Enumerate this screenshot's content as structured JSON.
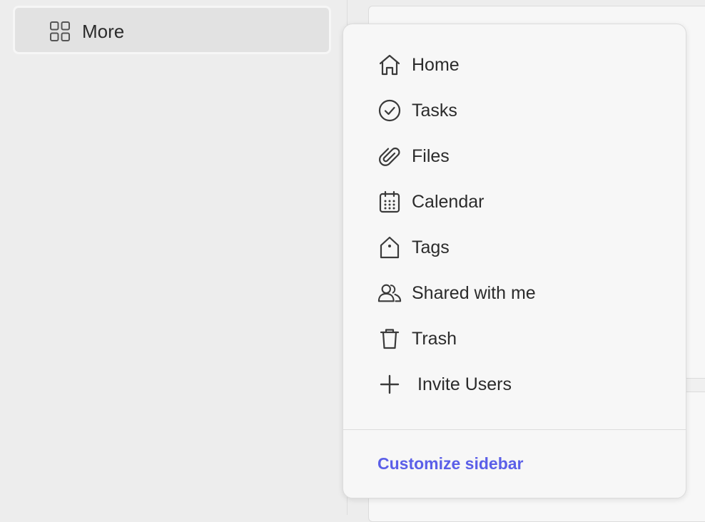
{
  "sidebar": {
    "more_item": {
      "label": "More",
      "icon": "grid-icon"
    }
  },
  "dropdown": {
    "items": [
      {
        "label": "Home",
        "icon": "home-icon"
      },
      {
        "label": "Tasks",
        "icon": "check-circle-icon"
      },
      {
        "label": "Files",
        "icon": "paperclip-icon"
      },
      {
        "label": "Calendar",
        "icon": "calendar-icon"
      },
      {
        "label": "Tags",
        "icon": "tag-icon"
      },
      {
        "label": "Shared with me",
        "icon": "users-icon"
      },
      {
        "label": "Trash",
        "icon": "trash-icon"
      },
      {
        "label": "Invite Users",
        "icon": "plus-icon"
      }
    ],
    "customize_label": "Customize sidebar"
  },
  "colors": {
    "accent": "#5b5fe8",
    "background": "#ededed",
    "menu_background": "#f7f7f7",
    "text": "#2b2b2b"
  }
}
